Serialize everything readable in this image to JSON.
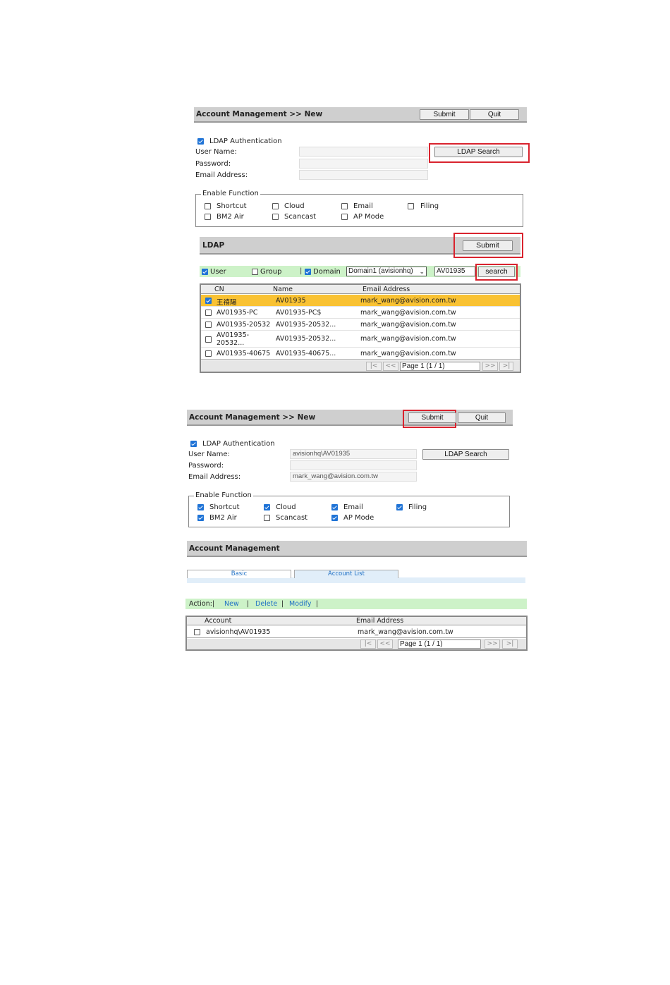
{
  "screen1": {
    "header": {
      "title": "Account Management >> New",
      "submit": "Submit",
      "quit": "Quit"
    },
    "ldap_auth": {
      "label": "LDAP Authentication",
      "checked": true
    },
    "fields": {
      "username_label": "User Name:",
      "password_label": "Password:",
      "email_label": "Email Address:"
    },
    "ldap_search_button": "LDAP Search",
    "enable_function": {
      "legend": "Enable Function",
      "items": [
        {
          "label": "Shortcut",
          "checked": false
        },
        {
          "label": "Cloud",
          "checked": false
        },
        {
          "label": "Email",
          "checked": false
        },
        {
          "label": "Filing",
          "checked": false
        },
        {
          "label": "BM2 Air",
          "checked": false
        },
        {
          "label": "Scancast",
          "checked": false
        },
        {
          "label": "AP Mode",
          "checked": false
        }
      ]
    },
    "ldap_panel": {
      "title": "LDAP",
      "submit": "Submit",
      "filter": {
        "user": "User",
        "user_checked": true,
        "group": "Group",
        "group_checked": false,
        "domain": "Domain",
        "domain_checked": true,
        "domain_select": "Domain1 (avisionhq)",
        "search_value": "AV01935",
        "search_button": "search"
      },
      "columns": [
        "CN",
        "Name",
        "Email Address"
      ],
      "rows": [
        {
          "cn": "王禧陽",
          "name": "AV01935",
          "email": "mark_wang@avision.com.tw",
          "checked": true
        },
        {
          "cn": "AV01935-PC",
          "name": "AV01935-PC$",
          "email": "mark_wang@avision.com.tw",
          "checked": false
        },
        {
          "cn": "AV01935-20532",
          "name": "AV01935-20532...",
          "email": "mark_wang@avision.com.tw",
          "checked": false
        },
        {
          "cn": "AV01935-\n20532...",
          "name": "AV01935-20532...",
          "email": "mark_wang@avision.com.tw",
          "checked": false
        },
        {
          "cn": "AV01935-40675",
          "name": "AV01935-40675...",
          "email": "mark_wang@avision.com.tw",
          "checked": false
        }
      ],
      "pager": {
        "first": "|<",
        "prev": "<<",
        "page": "Page 1 (1 / 1)",
        "next": ">>",
        "last": ">|"
      }
    }
  },
  "screen2": {
    "header": {
      "title": "Account Management >> New",
      "submit": "Submit",
      "quit": "Quit"
    },
    "ldap_auth": {
      "label": "LDAP Authentication",
      "checked": true
    },
    "fields": {
      "username_label": "User Name:",
      "username_value": "avisionhq\\AV01935",
      "password_label": "Password:",
      "email_label": "Email Address:",
      "email_value": "mark_wang@avision.com.tw"
    },
    "ldap_search_button": "LDAP Search",
    "enable_function": {
      "legend": "Enable Function",
      "items": [
        {
          "label": "Shortcut",
          "checked": true
        },
        {
          "label": "Cloud",
          "checked": true
        },
        {
          "label": "Email",
          "checked": true
        },
        {
          "label": "Filing",
          "checked": true
        },
        {
          "label": "BM2 Air",
          "checked": true
        },
        {
          "label": "Scancast",
          "checked": false
        },
        {
          "label": "AP Mode",
          "checked": true
        }
      ]
    }
  },
  "screen3": {
    "header": {
      "title": "Account Management"
    },
    "tabs": [
      "Basic",
      "Account List"
    ],
    "action": {
      "label": "Action:|",
      "new": "New",
      "sep": "|",
      "delete": "Delete",
      "modify": "Modify"
    },
    "columns": [
      "Account",
      "Email Address"
    ],
    "rows": [
      {
        "account": "avisionhq\\AV01935",
        "email": "mark_wang@avision.com.tw",
        "checked": false
      }
    ],
    "pager": {
      "first": "|<",
      "prev": "<<",
      "page": "Page 1 (1 / 1)",
      "next": ">>",
      "last": ">|"
    }
  }
}
